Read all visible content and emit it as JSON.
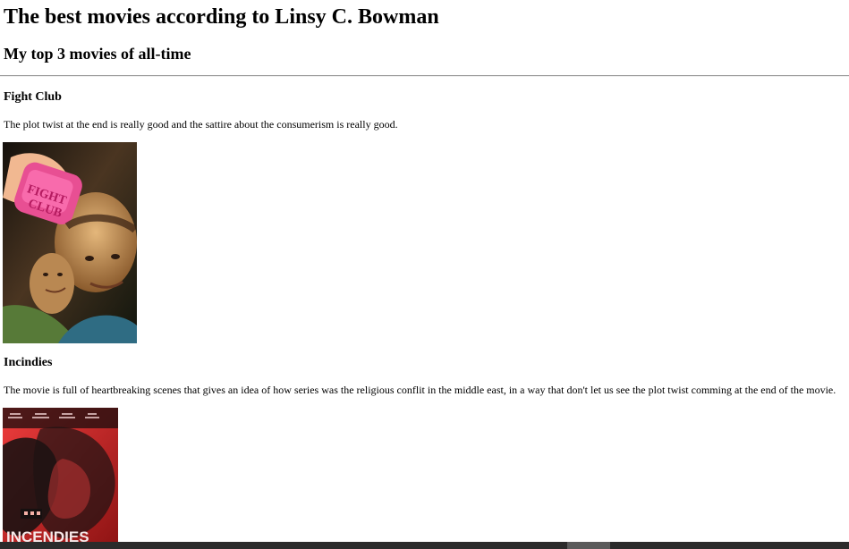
{
  "page": {
    "title": "The best movies according to Linsy C. Bowman",
    "subtitle": "My top 3 movies of all-time"
  },
  "movies": [
    {
      "title": "Fight Club",
      "description": "The plot twist at the end is really good and the sattire about the consumerism is really good.",
      "poster_text": "FIGHT CLUB"
    },
    {
      "title": "Incindies",
      "description": "The movie is full of heartbreaking scenes that gives an idea of how series was the religious conflit in the middle east, in a way that don't let us see the plot twist comming at the end of the movie.",
      "poster_text": "INCENDIES"
    }
  ],
  "colors": {
    "background": "#ffffff",
    "text": "#000000",
    "rule": "#9a9a9a",
    "scrollbar_track": "#2b2b2b",
    "scrollbar_thumb": "#5b5b5b",
    "poster1_accent": "#e84f93",
    "poster2_accent": "#d62a2a"
  }
}
